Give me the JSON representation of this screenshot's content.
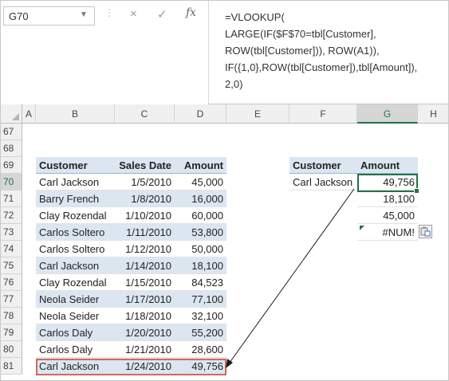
{
  "formula_bar": {
    "name_box": "G70",
    "separator": "⋮",
    "cancel_icon": "×",
    "enter_icon": "✓",
    "fx_label": "fx",
    "formula": "=VLOOKUP(\nLARGE(IF($F$70=tbl[Customer],\nROW(tbl[Customer])), ROW(A1)),\nIF({1,0},ROW(tbl[Customer]),tbl[Amount]),\n2,0)"
  },
  "columns": [
    "A",
    "B",
    "C",
    "D",
    "E",
    "F",
    "G",
    "H"
  ],
  "rows": [
    "67",
    "68",
    "69",
    "70",
    "71",
    "72",
    "73",
    "74",
    "75",
    "76",
    "77",
    "78",
    "79",
    "80",
    "81"
  ],
  "table": {
    "headers": [
      "Customer",
      "Sales Date",
      "Amount"
    ],
    "rows": [
      [
        "Carl Jackson",
        "1/5/2010",
        "45,000"
      ],
      [
        "Barry French",
        "1/8/2010",
        "16,000"
      ],
      [
        "Clay Rozendal",
        "1/10/2010",
        "60,000"
      ],
      [
        "Carlos Soltero",
        "1/11/2010",
        "53,800"
      ],
      [
        "Carlos Soltero",
        "1/12/2010",
        "50,000"
      ],
      [
        "Carl Jackson",
        "1/14/2010",
        "18,100"
      ],
      [
        "Clay Rozendal",
        "1/15/2010",
        "84,523"
      ],
      [
        "Neola Seider",
        "1/17/2010",
        "77,100"
      ],
      [
        "Neola Seider",
        "1/18/2010",
        "32,100"
      ],
      [
        "Carlos Daly",
        "1/20/2010",
        "55,200"
      ],
      [
        "Carlos Daly",
        "1/21/2010",
        "28,600"
      ],
      [
        "Carl Jackson",
        "1/24/2010",
        "49,756"
      ]
    ]
  },
  "lookup": {
    "headers": [
      "Customer",
      "Amount"
    ],
    "customer": "Carl Jackson",
    "results": [
      "49,756",
      "18,100",
      "45,000",
      "#NUM!"
    ]
  },
  "selected_cell": "G70",
  "colors": {
    "accent": "#217346",
    "table_band": "#dce6f1",
    "highlight": "#d46a55"
  }
}
